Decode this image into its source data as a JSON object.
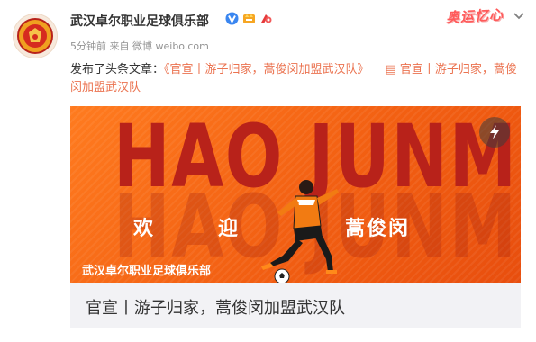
{
  "account": {
    "name": "武汉卓尔职业足球俱乐部",
    "avatar_icon": "club-crest-icon",
    "verified_icon": "verified-v-icon",
    "member_icon": "vip-badge-icon",
    "event_icon": "event-badge-icon"
  },
  "meta": {
    "time": "5分钟前",
    "source_prefix": "来自",
    "source": "微博 weibo.com"
  },
  "header_right": {
    "card_decoration": "奥运忆心",
    "menu_icon": "chevron-down-icon"
  },
  "post": {
    "prefix": "发布了头条文章：",
    "article_link": "《官宣丨游子归家，蒿俊闵加盟武汉队》",
    "article_icon": "article-icon",
    "article_short_link": "官宣丨游子归家，蒿俊闵加盟武汉队"
  },
  "banner": {
    "big_name": "HAO JUNMIN",
    "welcome_1": "欢",
    "welcome_2": "迎",
    "welcome_3": "蒿俊闵",
    "club_caption": "武汉卓尔职业足球俱乐部",
    "flash_icon": "lightning-icon"
  },
  "article_title": "官宣丨游子归家，蒿俊闵加盟武汉队",
  "colors": {
    "link": "#eb7350",
    "banner_orange": "#f25f12",
    "name_text": "#b8221a"
  }
}
